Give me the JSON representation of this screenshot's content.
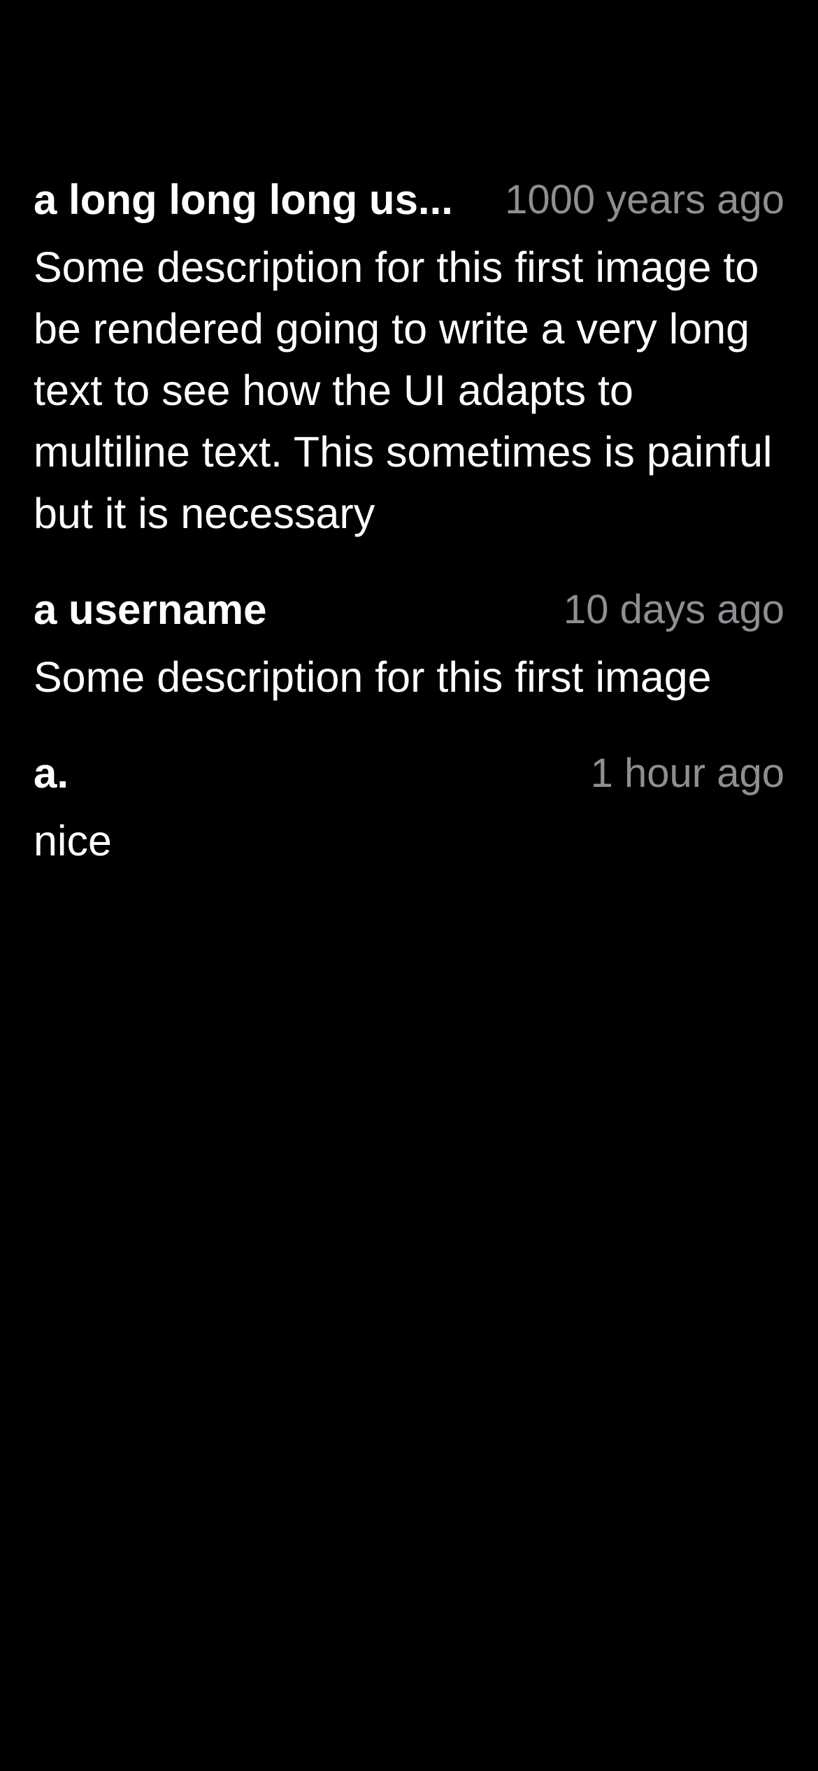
{
  "colors": {
    "background": "#000000",
    "text": "#ffffff",
    "secondary_text": "#8e8e93"
  },
  "comments": [
    {
      "username": "a long long long us...",
      "timestamp": "1000 years ago",
      "text": "Some description for this first image to be rendered going to write a very long text to see how the UI adapts to multiline text. This sometimes is painful but it is necessary"
    },
    {
      "username": "a username",
      "timestamp": "10 days ago",
      "text": "Some description for this first image"
    },
    {
      "username": "a.",
      "timestamp": "1 hour ago",
      "text": "nice"
    }
  ]
}
